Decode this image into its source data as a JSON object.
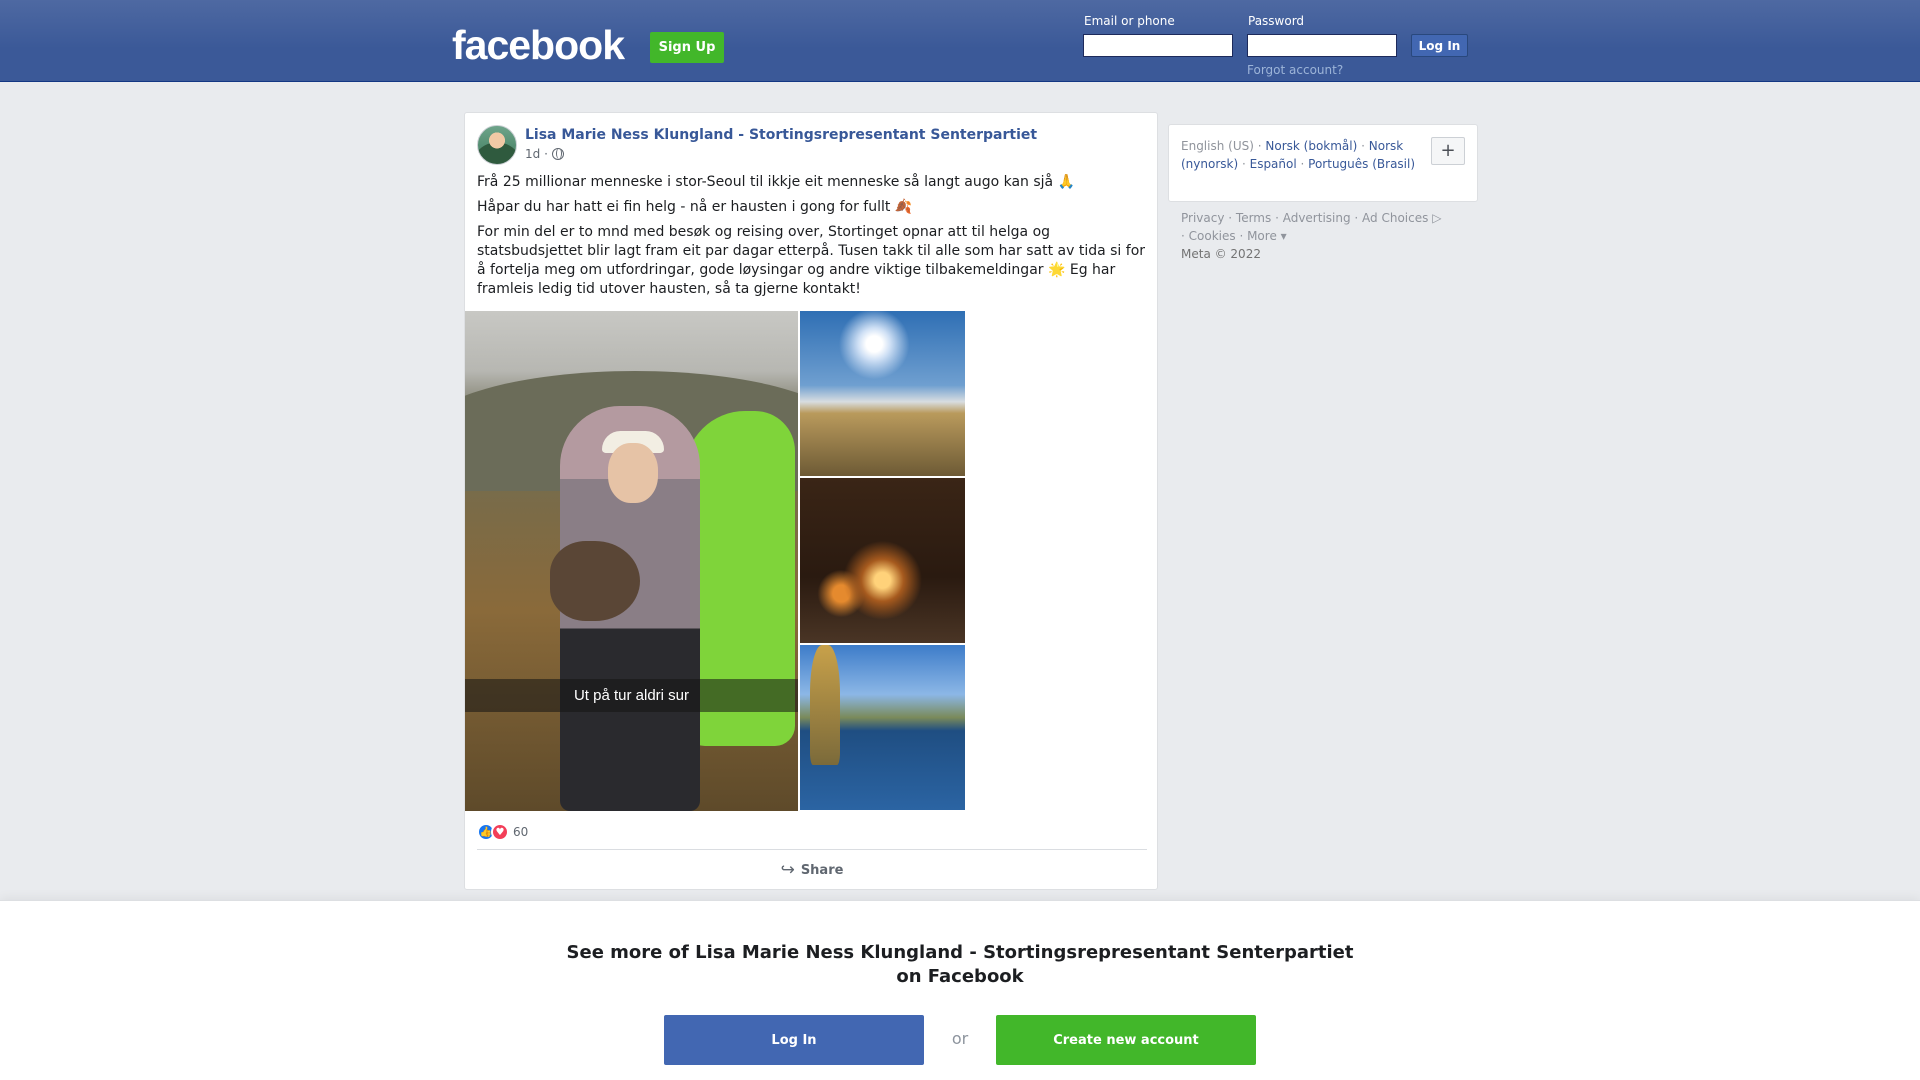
{
  "header": {
    "logo": "facebook",
    "signup_label": "Sign Up",
    "email_label": "Email or phone",
    "password_label": "Password",
    "login_label": "Log In",
    "forgot_label": "Forgot account?"
  },
  "post": {
    "author": "Lisa Marie Ness Klungland - Stortingsrepresentant Senterpartiet",
    "time": "1d ·",
    "paragraphs": [
      "Frå 25 millionar menneske i stor-Seoul til ikkje eit menneske så langt augo kan sjå 🙏",
      "Håpar du har hatt ei fin helg - nå er hausten i gong for fullt 🍂",
      "For min del er to mnd med besøk og reising over, Stortinget opnar att til helga og statsbudsjettet blir lagt fram eit par dagar etterpå. Tusen takk til alle som har satt av tida si for å fortelja meg om utfordringar, gode løysingar og andre viktige tilbakemeldingar 🌟 Eg har framleis ledig tid utover hausten, så ta gjerne kontakt!"
    ],
    "photo_caption": "Ut på tur aldri sur",
    "reaction_count": "60",
    "share_label": "Share"
  },
  "languages": {
    "current": "English (US)",
    "others": [
      "Norsk (bokmål)",
      "Norsk (nynorsk)",
      "Español",
      "Português (Brasil)"
    ],
    "plus": "+"
  },
  "footer": {
    "links": [
      "Privacy",
      "Terms",
      "Advertising",
      "Ad Choices",
      "Cookies",
      "More"
    ],
    "copyright": "Meta © 2022"
  },
  "bottom": {
    "title": "See more of Lisa Marie Ness Klungland - Stortingsrepresentant Senterpartiet on Facebook",
    "login_label": "Log In",
    "or_label": "or",
    "create_label": "Create new account"
  },
  "colors": {
    "brand": "#3b5998",
    "link": "#385898",
    "green": "#42b72a"
  }
}
